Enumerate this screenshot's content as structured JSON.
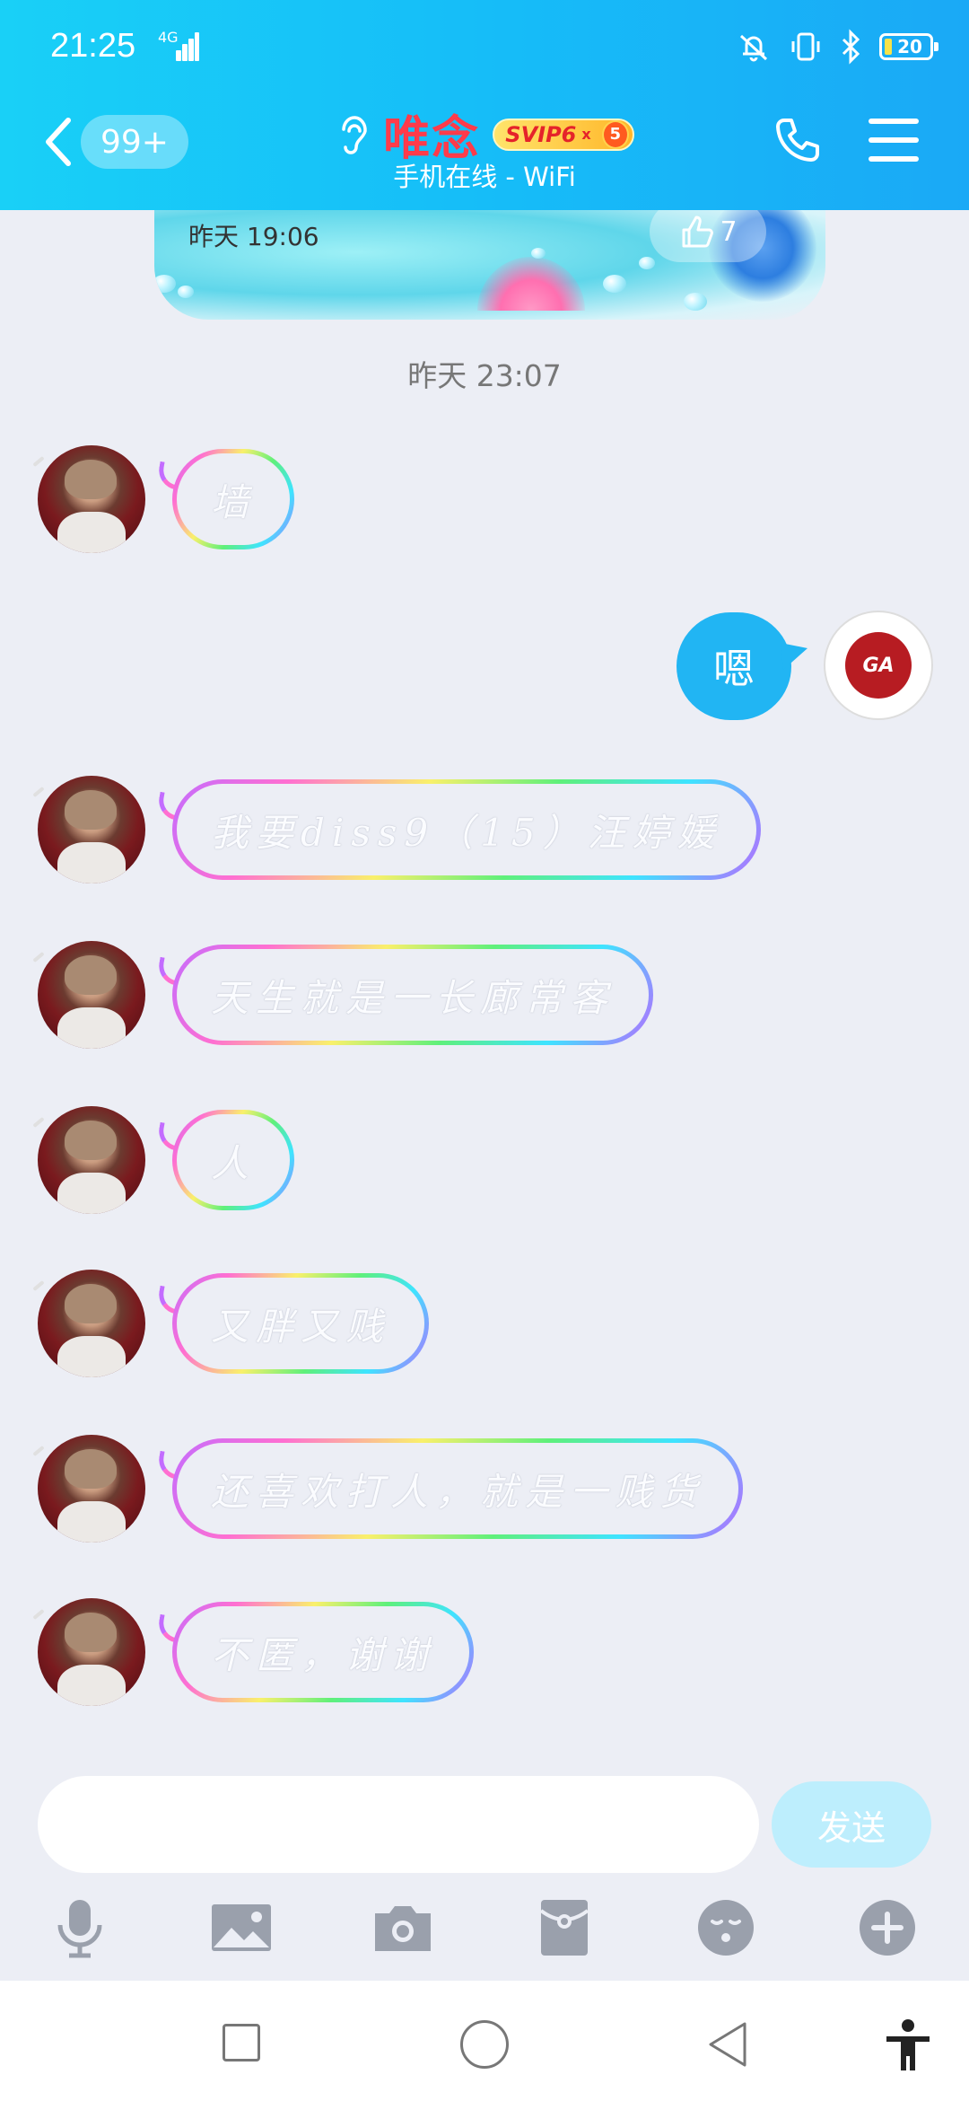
{
  "status_bar": {
    "time": "21:25",
    "network": "4G",
    "battery": "20"
  },
  "header": {
    "unread_badge": "99+",
    "contact_name": "唯念",
    "vip_label": "SVIP6",
    "vip_multiplier": "x",
    "vip_level": "5",
    "subtitle": "手机在线 - WiFi"
  },
  "previous_card": {
    "time": "昨天 19:06",
    "likes": "7"
  },
  "timestamp": "昨天 23:07",
  "messages": [
    {
      "from": "contact",
      "text": "墙"
    },
    {
      "from": "me",
      "text": "嗯"
    },
    {
      "from": "contact",
      "text": "我要diss9（15）汪婷媛"
    },
    {
      "from": "contact",
      "text": "天生就是一长廊常客"
    },
    {
      "from": "contact",
      "text": "人"
    },
    {
      "from": "contact",
      "text": "又胖又贱"
    },
    {
      "from": "contact",
      "text": "还喜欢打人，就是一贱货"
    },
    {
      "from": "contact",
      "text": "不匿，谢谢"
    }
  ],
  "my_avatar_text": "GA",
  "composer": {
    "input_value": "",
    "send_label": "发送"
  },
  "toolbar_icons": [
    "microphone-icon",
    "image-icon",
    "camera-icon",
    "red-packet-icon",
    "emoji-icon",
    "plus-icon"
  ],
  "colors": {
    "header": "#16bdf8",
    "my_bubble": "#21b5f3",
    "contact_name": "#ff3b4a",
    "background": "#eceef5"
  }
}
